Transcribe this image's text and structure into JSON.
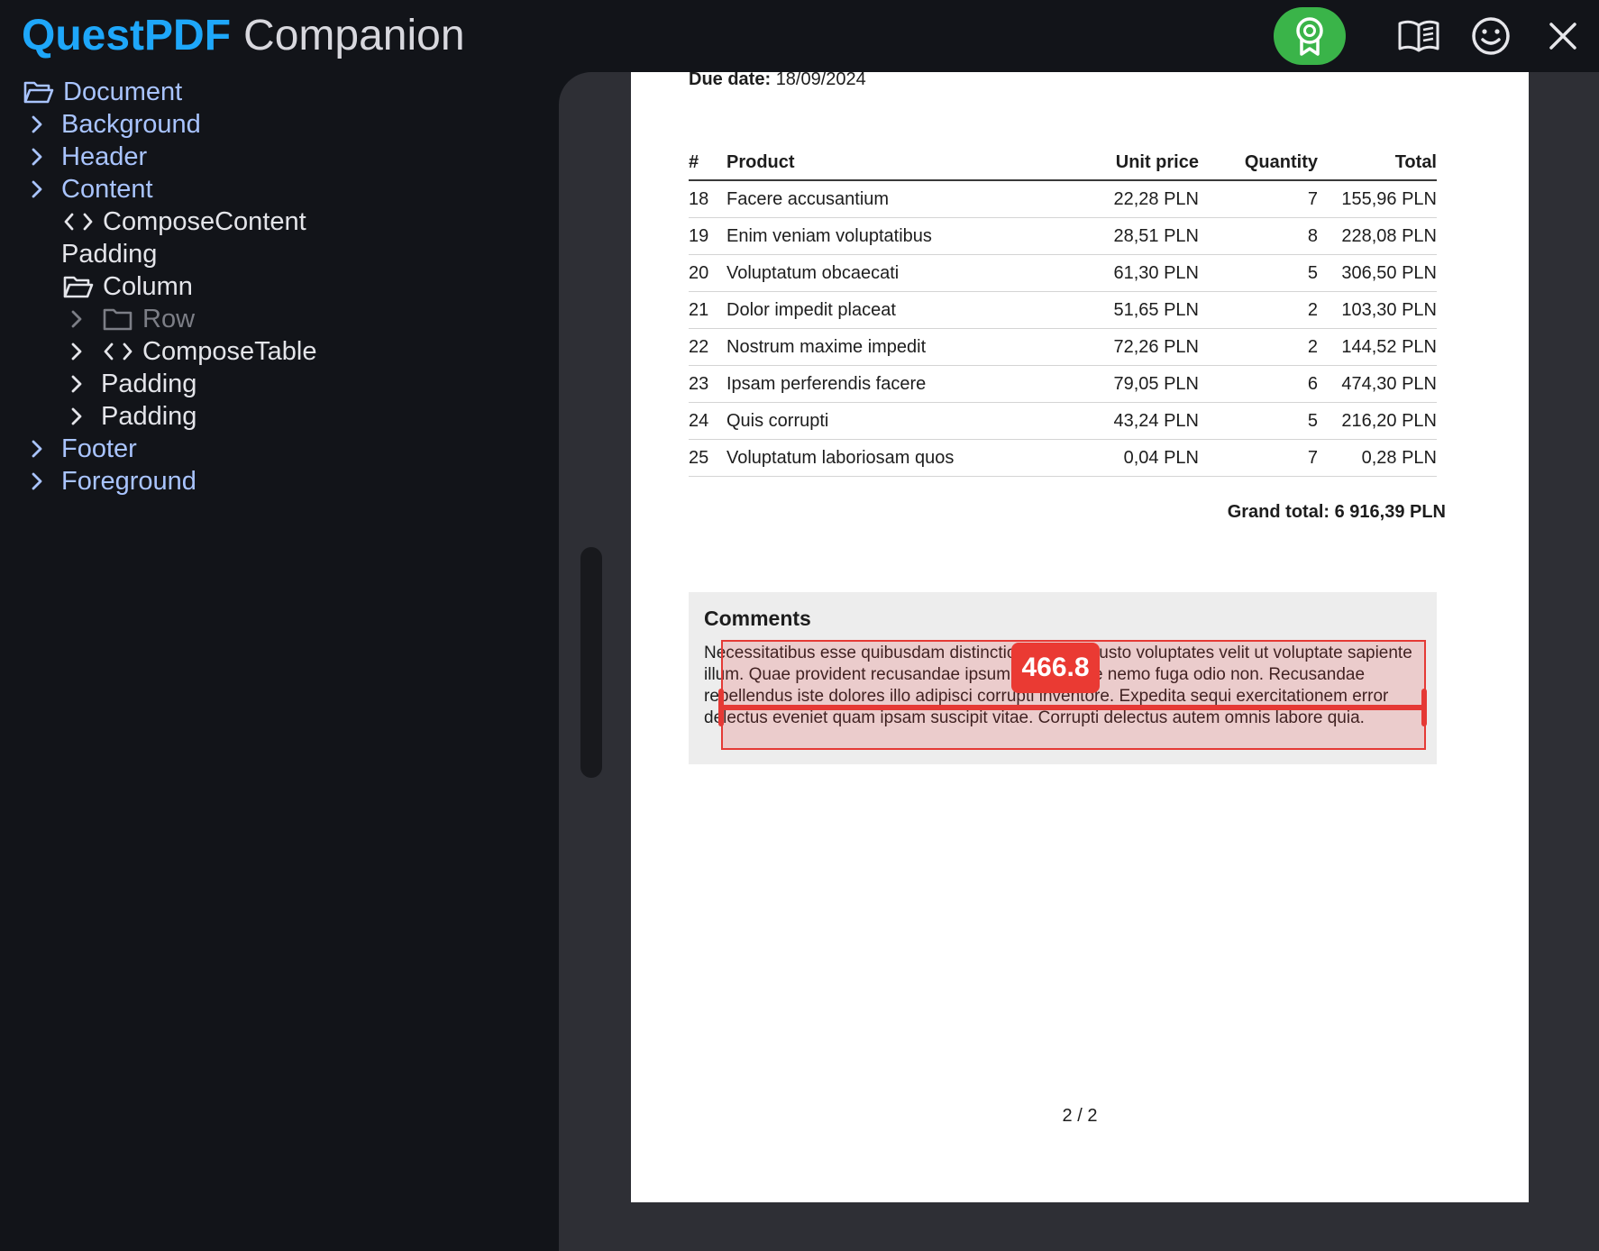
{
  "app": {
    "brand": "QuestPDF",
    "suffix": "Companion",
    "colors": {
      "brand": "#1ea7fa",
      "license_button": "#3ab449",
      "tree_link": "#a9c4ff",
      "highlight": "#e53935"
    }
  },
  "toolbar": [
    {
      "name": "license-button",
      "icon": "award-ribbon-icon"
    },
    {
      "name": "documentation-button",
      "icon": "open-book-icon"
    },
    {
      "name": "feedback-button",
      "icon": "smiley-face-icon"
    },
    {
      "name": "close-button",
      "icon": "close-icon"
    }
  ],
  "tree": [
    {
      "label": "Document",
      "icon": "folder-open-icon",
      "style": "blue"
    },
    {
      "label": "Background",
      "icon": "chevron-right-icon",
      "style": "blue"
    },
    {
      "label": "Header",
      "icon": "chevron-right-icon",
      "style": "blue"
    },
    {
      "label": "Content",
      "icon": "chevron-right-icon",
      "style": "blue"
    },
    {
      "label": "ComposeContent",
      "icon": "code-icon",
      "style": "light"
    },
    {
      "label": "Padding",
      "icon": "",
      "style": "light"
    },
    {
      "label": "Column",
      "icon": "folder-open-icon",
      "style": "light"
    },
    {
      "label": "Row",
      "icon": "folder-icon",
      "style": "dim"
    },
    {
      "label": "ComposeTable",
      "icon": "code-icon",
      "style": "light"
    },
    {
      "label": "Padding",
      "icon": "chevron-right-icon",
      "style": "light"
    },
    {
      "label": "Padding",
      "icon": "chevron-right-icon",
      "style": "light"
    },
    {
      "label": "Footer",
      "icon": "chevron-right-icon",
      "style": "blue"
    },
    {
      "label": "Foreground",
      "icon": "chevron-right-icon",
      "style": "blue"
    }
  ],
  "document": {
    "due_date_label": "Due date:",
    "due_date_value": "18/09/2024",
    "table": {
      "headers": {
        "num": "#",
        "product": "Product",
        "unit_price": "Unit price",
        "quantity": "Quantity",
        "total": "Total"
      },
      "rows": [
        {
          "num": "18",
          "product": "Facere accusantium",
          "unit_price": "22,28 PLN",
          "quantity": "7",
          "total": "155,96 PLN"
        },
        {
          "num": "19",
          "product": "Enim veniam voluptatibus",
          "unit_price": "28,51 PLN",
          "quantity": "8",
          "total": "228,08 PLN"
        },
        {
          "num": "20",
          "product": "Voluptatum obcaecati",
          "unit_price": "61,30 PLN",
          "quantity": "5",
          "total": "306,50 PLN"
        },
        {
          "num": "21",
          "product": "Dolor impedit placeat",
          "unit_price": "51,65 PLN",
          "quantity": "2",
          "total": "103,30 PLN"
        },
        {
          "num": "22",
          "product": "Nostrum maxime impedit",
          "unit_price": "72,26 PLN",
          "quantity": "2",
          "total": "144,52 PLN"
        },
        {
          "num": "23",
          "product": "Ipsam perferendis facere",
          "unit_price": "79,05 PLN",
          "quantity": "6",
          "total": "474,30 PLN"
        },
        {
          "num": "24",
          "product": "Quis corrupti",
          "unit_price": "43,24 PLN",
          "quantity": "5",
          "total": "216,20 PLN"
        },
        {
          "num": "25",
          "product": "Voluptatum laboriosam quos",
          "unit_price": "0,04 PLN",
          "quantity": "7",
          "total": "0,28 PLN"
        }
      ]
    },
    "grand_total": "Grand total: 6 916,39 PLN",
    "comments_title": "Comments",
    "comments_text": "Necessitatibus esse quibusdam distinctio doloribus iusto voluptates velit ut voluptate sapiente illum. Quae provident recusandae ipsum iusto saepe nemo fuga odio non. Recusandae repellendus iste dolores illo adipisci corrupti inventore. Expedita sequi exercitationem error delectus eveniet quam ipsam suscipit vitae. Corrupti delectus autem omnis labore quia.",
    "page_number": "2 / 2"
  },
  "measurement": {
    "value": "466.8"
  }
}
